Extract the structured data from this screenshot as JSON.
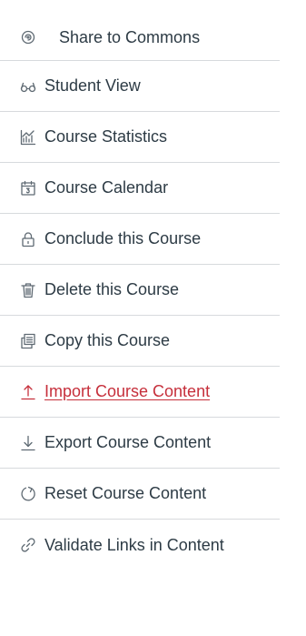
{
  "colors": {
    "accent": "#c62f3b",
    "text": "#2d3b45",
    "divider": "#d7dadd"
  },
  "menu": {
    "items": [
      {
        "label": "Share to Commons",
        "icon": "share-commons-icon"
      },
      {
        "label": "Student View",
        "icon": "glasses-icon"
      },
      {
        "label": "Course Statistics",
        "icon": "stats-chart-icon"
      },
      {
        "label": "Course Calendar",
        "icon": "calendar-icon"
      },
      {
        "label": "Conclude this Course",
        "icon": "lock-icon"
      },
      {
        "label": "Delete this Course",
        "icon": "trash-icon"
      },
      {
        "label": "Copy this Course",
        "icon": "copy-icon"
      },
      {
        "label": "Import Course Content",
        "icon": "upload-icon",
        "active": true
      },
      {
        "label": "Export Course Content",
        "icon": "download-icon"
      },
      {
        "label": "Reset Course Content",
        "icon": "reset-icon"
      },
      {
        "label": "Validate Links in Content",
        "icon": "link-icon"
      }
    ]
  }
}
